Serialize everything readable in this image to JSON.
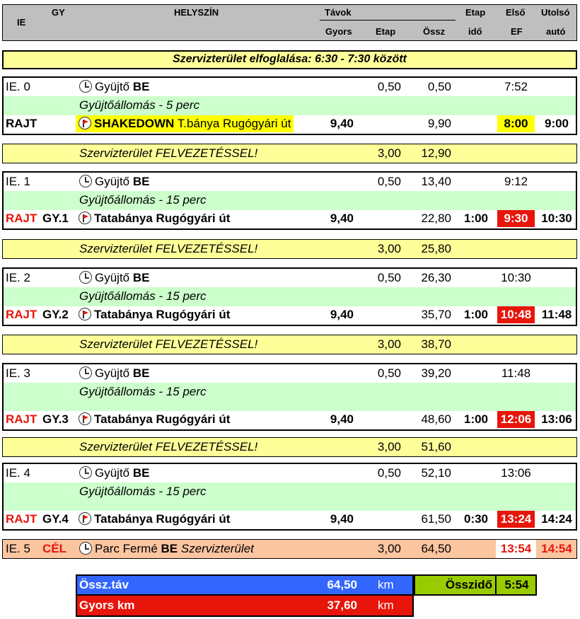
{
  "header": {
    "ie": "IE",
    "gy": "GY",
    "helyszin": "HELYSZÍN",
    "tavok": "Távok",
    "gyors": "Gyors",
    "etap": "Etap",
    "ossz": "Össz",
    "etap_ido_1": "Etap",
    "etap_ido_2": "idő",
    "elso_1": "Első",
    "elso_2": "EF",
    "utolso_1": "Utolsó",
    "utolso_2": "autó"
  },
  "service_occupy": "Szervizterület elfoglalása: 6:30 - 7:30 között",
  "blocks": [
    {
      "ie": "IE. 0",
      "gyujto": "Gyüjtő",
      "be": "BE",
      "etap": "0,50",
      "ossz": "0,50",
      "time": "7:52",
      "gyujto_allomas": "Gyüjtőállomás - 5 perc",
      "rajt": "RAJT",
      "gy": "",
      "loc_bold": "SHAKEDOWN",
      "loc_rest": " T.bánya Rugógyári út",
      "gyors": "9,40",
      "ossz2": "9,90",
      "etap_ido": "",
      "elso": "8:00",
      "utolso": "9:00"
    },
    {
      "ie": "IE. 1",
      "gyujto": "Gyüjtő",
      "be": "BE",
      "etap": "0,50",
      "ossz": "13,40",
      "time": "9:12",
      "gyujto_allomas": "Gyüjtőállomás - 15 perc",
      "rajt": "RAJT",
      "gy": "GY.1",
      "loc_bold": "Tatabánya Rugógyári út",
      "loc_rest": "",
      "gyors": "9,40",
      "ossz2": "22,80",
      "etap_ido": "1:00",
      "elso": "9:30",
      "utolso": "10:30"
    },
    {
      "ie": "IE. 2",
      "gyujto": "Gyüjtő",
      "be": "BE",
      "etap": "0,50",
      "ossz": "26,30",
      "time": "10:30",
      "gyujto_allomas": "Gyüjtőállomás - 15 perc",
      "rajt": "RAJT",
      "gy": "GY.2",
      "loc_bold": "Tatabánya Rugógyári út",
      "loc_rest": "",
      "gyors": "9,40",
      "ossz2": "35,70",
      "etap_ido": "1:00",
      "elso": "10:48",
      "utolso": "11:48"
    },
    {
      "ie": "IE. 3",
      "gyujto": "Gyüjtő",
      "be": "BE",
      "etap": "0,50",
      "ossz": "39,20",
      "time": "11:48",
      "gyujto_allomas": "Gyüjtőállomás - 15 perc",
      "rajt": "RAJT",
      "gy": "GY.3",
      "loc_bold": "Tatabánya Rugógyári út",
      "loc_rest": "",
      "gyors": "9,40",
      "ossz2": "48,60",
      "etap_ido": "1:00",
      "elso": "12:06",
      "utolso": "13:06"
    },
    {
      "ie": "IE. 4",
      "gyujto": "Gyüjtő",
      "be": "BE",
      "etap": "0,50",
      "ossz": "52,10",
      "time": "13:06",
      "gyujto_allomas": "Gyüjtőállomás - 15 perc",
      "rajt": "RAJT",
      "gy": "GY.4",
      "loc_bold": "Tatabánya Rugógyári út",
      "loc_rest": "",
      "gyors": "9,40",
      "ossz2": "61,50",
      "etap_ido": "0:30",
      "elso": "13:24",
      "utolso": "14:24"
    }
  ],
  "service_rows": [
    {
      "label": "Szervizterület FELVEZETÉSSEL!",
      "etap": "3,00",
      "ossz": "12,90"
    },
    {
      "label": "Szervizterület FELVEZETÉSSEL!",
      "etap": "3,00",
      "ossz": "25,80"
    },
    {
      "label": "Szervizterület FELVEZETÉSSEL!",
      "etap": "3,00",
      "ossz": "38,70"
    },
    {
      "label": "Szervizterület FELVEZETÉSSEL!",
      "etap": "3,00",
      "ossz": "51,60"
    }
  ],
  "finish": {
    "ie": "IE. 5",
    "cel": "CÉL",
    "parc": "Parc Fermé",
    "be": "BE",
    "szerviz": "Szervizterület",
    "etap": "3,00",
    "ossz": "64,50",
    "elso": "13:54",
    "utolso": "14:54"
  },
  "summary": {
    "ossz_tav_label": "Össz.táv",
    "ossz_tav_value": "64,50",
    "km1": "km",
    "gyors_label": "Gyors km",
    "gyors_value": "37,60",
    "km2": "km",
    "osszido_label": "Összidő",
    "osszido_value": "5:54"
  },
  "colors": {
    "header_gray": "#bfbfbf",
    "yellow": "#ffff99",
    "green": "#ccffcc",
    "peach": "#fbc5a0",
    "red": "#e8150b",
    "blue": "#3366ff",
    "olive": "#99cc00"
  }
}
